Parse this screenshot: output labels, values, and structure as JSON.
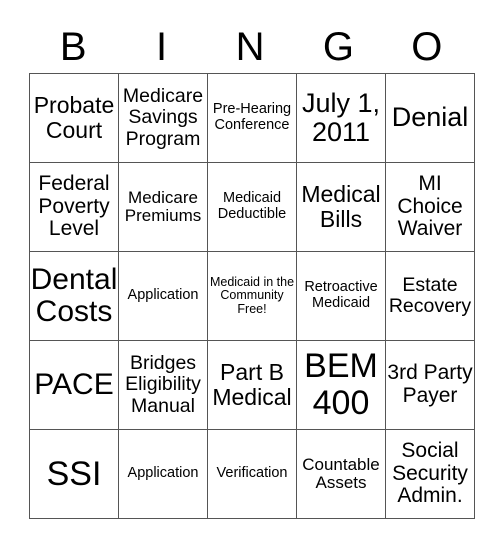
{
  "header": {
    "letters": [
      "B",
      "I",
      "N",
      "G",
      "O"
    ]
  },
  "rows": [
    [
      "Probate Court",
      "Medicare Savings Program",
      "Pre-Hearing Conference",
      "July 1, 2011",
      "Denial"
    ],
    [
      "Federal Poverty Level",
      "Medicare Premiums",
      "Medicaid Deductible",
      "Medical Bills",
      "MI Choice Waiver"
    ],
    [
      "Dental Costs",
      "Application",
      "Medicaid in the Community Free!",
      "Retroactive Medicaid",
      "Estate Recovery"
    ],
    [
      "PACE",
      "Bridges Eligibility Manual",
      "Part B Medical",
      "BEM 400",
      "3rd Party Payer"
    ],
    [
      "SSI",
      "Application",
      "Verification",
      "Countable Assets",
      "Social Security Admin."
    ]
  ]
}
